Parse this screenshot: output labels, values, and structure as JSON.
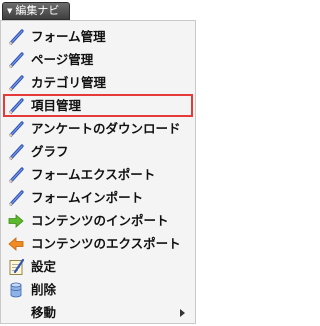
{
  "tab": {
    "label": "編集ナビ"
  },
  "menu": {
    "items": [
      {
        "label": "フォーム管理",
        "icon": "pencil-icon"
      },
      {
        "label": "ページ管理",
        "icon": "pencil-icon"
      },
      {
        "label": "カテゴリ管理",
        "icon": "pencil-icon"
      },
      {
        "label": "項目管理",
        "icon": "pencil-icon",
        "highlighted": true
      },
      {
        "label": "アンケートのダウンロード",
        "icon": "pencil-icon"
      },
      {
        "label": "グラフ",
        "icon": "pencil-icon"
      },
      {
        "label": "フォームエクスポート",
        "icon": "pencil-icon"
      },
      {
        "label": "フォームインポート",
        "icon": "pencil-icon"
      },
      {
        "label": "コンテンツのインポート",
        "icon": "green-arrow-right-icon"
      },
      {
        "label": "コンテンツのエクスポート",
        "icon": "orange-arrow-left-icon"
      },
      {
        "label": "設定",
        "icon": "notepad-icon"
      },
      {
        "label": "削除",
        "icon": "database-icon"
      },
      {
        "label": "移動",
        "icon": "none",
        "has_submenu": true
      }
    ]
  },
  "colors": {
    "highlight_border": "#e63a3a",
    "menu_background": "#f4f4f4",
    "tab_background": "#4a4a4a"
  }
}
